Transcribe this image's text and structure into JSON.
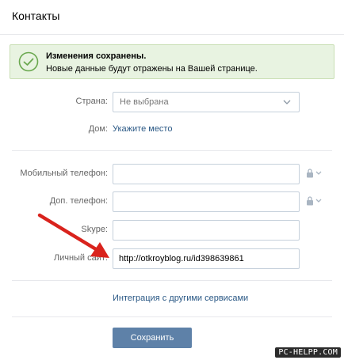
{
  "header": {
    "title": "Контакты"
  },
  "notice": {
    "title": "Изменения сохранены.",
    "text": "Новые данные будут отражены на Вашей странице."
  },
  "country": {
    "label": "Страна:",
    "value": "Не выбрана"
  },
  "home": {
    "label": "Дом:",
    "link": "Укажите место"
  },
  "mobile": {
    "label": "Мобильный телефон:",
    "value": ""
  },
  "extra_phone": {
    "label": "Доп. телефон:",
    "value": ""
  },
  "skype": {
    "label": "Skype:",
    "value": ""
  },
  "site": {
    "label": "Личный сайт:",
    "value": "http://otkroyblog.ru/id398639861"
  },
  "integration": {
    "link": "Интеграция с другими сервисами"
  },
  "save": {
    "label": "Сохранить"
  },
  "watermark": {
    "text": "PC-HELPP.COM"
  },
  "colors": {
    "accent": "#5e81a8",
    "link": "#2a5885",
    "success_bg": "#e8f3e1",
    "arrow": "#d9231d"
  },
  "icons": [
    "check-circle-icon",
    "chevron-down-icon",
    "lock-icon",
    "red-arrow-icon"
  ]
}
